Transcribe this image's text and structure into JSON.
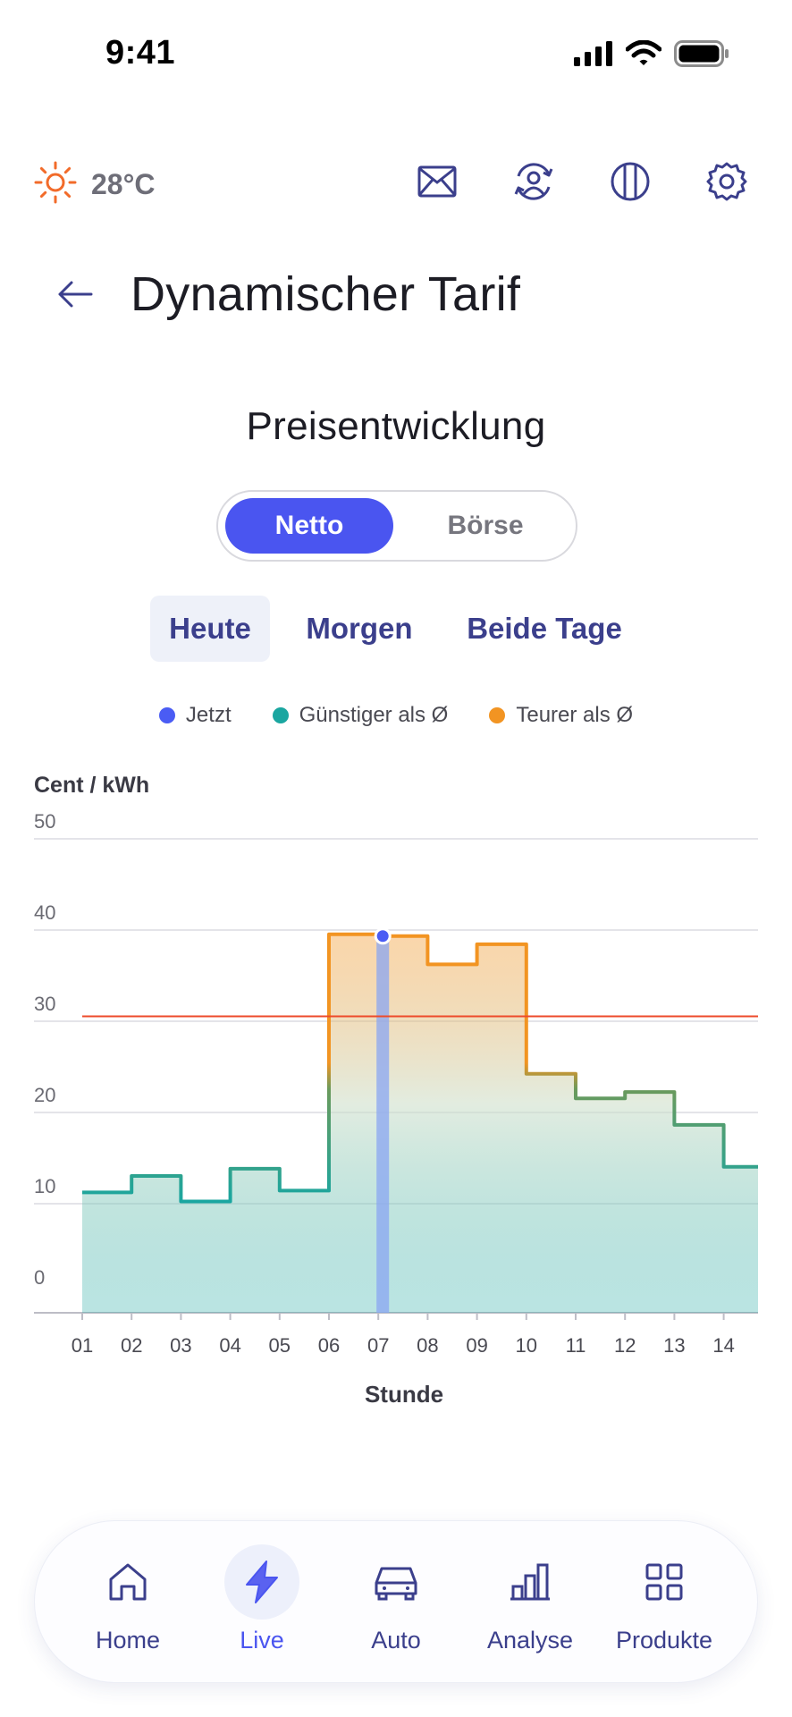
{
  "status_bar": {
    "time": "9:41"
  },
  "weather": {
    "temperature": "28°C"
  },
  "header": {
    "title": "Dynamischer Tarif"
  },
  "section": {
    "title": "Preisentwicklung"
  },
  "segment": {
    "options": [
      "Netto",
      "Börse"
    ],
    "selected": "Netto"
  },
  "day_tabs": {
    "items": [
      "Heute",
      "Morgen",
      "Beide Tage"
    ],
    "selected": "Heute"
  },
  "legend": {
    "items": [
      "Jetzt",
      "Günstiger als Ø",
      "Teurer als Ø"
    ]
  },
  "colors": {
    "accent": "#4a55f0",
    "now": "#4a5cf4",
    "cheaper": "#1aa6a0",
    "expensive": "#f29422",
    "average_line": "#ee4b2b",
    "nav_text": "#3b3f8c"
  },
  "chart_data": {
    "type": "area",
    "step": true,
    "ylabel": "Cent / kWh",
    "xlabel": "Stunde",
    "ylim": [
      0,
      50
    ],
    "yticks": [
      "0",
      "10",
      "20",
      "30",
      "40",
      "50"
    ],
    "categories": [
      "01",
      "02",
      "03",
      "04",
      "05",
      "06",
      "07",
      "08",
      "09",
      "10",
      "11",
      "12",
      "13",
      "14"
    ],
    "values": [
      13.2,
      15,
      12.2,
      15.8,
      13.4,
      41.5,
      41.3,
      38.2,
      40.4,
      26.2,
      23.5,
      24.2,
      20.6,
      16
    ],
    "average": 32.5,
    "now_index": 6,
    "grid": true
  },
  "bottom_nav": {
    "items": [
      {
        "label": "Home",
        "icon": "home-icon"
      },
      {
        "label": "Live",
        "icon": "lightning-icon"
      },
      {
        "label": "Auto",
        "icon": "car-icon"
      },
      {
        "label": "Analyse",
        "icon": "bar-chart-icon"
      },
      {
        "label": "Produkte",
        "icon": "grid-icon"
      }
    ],
    "selected": "Live"
  }
}
